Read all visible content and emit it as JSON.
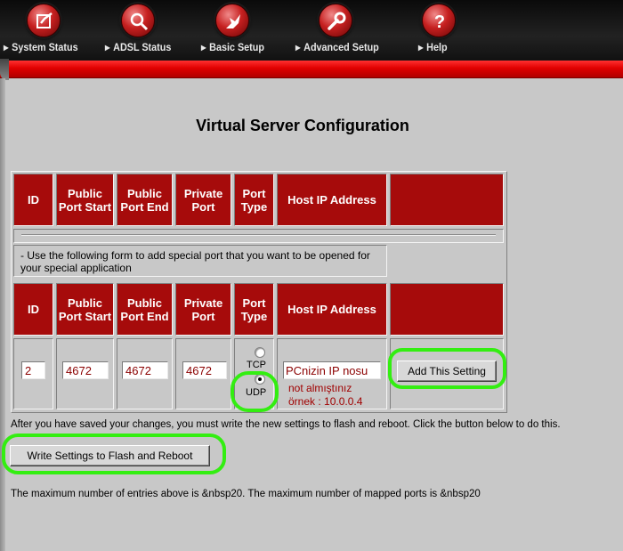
{
  "nav": {
    "items": [
      {
        "label": "System Status",
        "icon": "status-icon"
      },
      {
        "label": "ADSL Status",
        "icon": "magnifier-icon"
      },
      {
        "label": "Basic Setup",
        "icon": "pointer-hand-icon"
      },
      {
        "label": "Advanced Setup",
        "icon": "wrench-icon"
      },
      {
        "label": "Help",
        "icon": "question-icon"
      }
    ],
    "accent_color": "#cc0000"
  },
  "page": {
    "title": "Virtual Server Configuration"
  },
  "table": {
    "headers": {
      "id": "ID",
      "public_start": "Public Port Start",
      "public_end": "Public Port End",
      "private": "Private Port",
      "type": "Port Type",
      "host": "Host IP Address"
    },
    "info_text": "- Use the following form to add special port that you want to be opened for your special application",
    "header_color": "#a60b0b"
  },
  "form": {
    "id_value": "2",
    "public_start_value": "4672",
    "public_end_value": "4672",
    "private_value": "4672",
    "port_type_options": [
      "TCP",
      "UDP"
    ],
    "port_type_selected": "UDP",
    "host_value": "PCnizin IP nosu",
    "host_note_line1": "not almıştınız",
    "host_note_line2": "örnek : 10.0.0.4",
    "add_button": "Add This Setting"
  },
  "footer": {
    "save_note": "After you have saved your changes, you must write the new settings to flash and reboot. Click the button below to do this.",
    "write_button": "Write Settings to Flash and Reboot",
    "max_note": "The maximum number of entries above is &nbsp20. The maximum number of mapped ports is &nbsp20"
  },
  "annotation_color": "#33ee11"
}
